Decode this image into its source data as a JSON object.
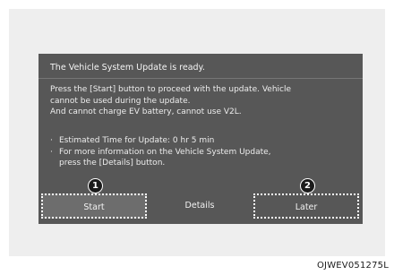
{
  "popup": {
    "title": "The Vehicle System Update is ready.",
    "message_lines": [
      "Press the [Start] button to proceed with the update. Vehicle",
      "cannot be used during the update.",
      "And cannot charge EV battery, cannot use V2L."
    ],
    "bullets": [
      {
        "marker": "·",
        "lines": [
          "Estimated Time for Update: 0 hr 5 min"
        ]
      },
      {
        "marker": "·",
        "lines": [
          "For more information on the Vehicle System Update,",
          "press the [Details] button."
        ]
      }
    ],
    "buttons": {
      "start": "Start",
      "details": "Details",
      "later": "Later"
    }
  },
  "callouts": {
    "start": "1",
    "later": "2"
  },
  "figure_code": "OJWEV051275L",
  "colors": {
    "popup_background": "#575757",
    "page_background": "#eeeeee",
    "highlight_border": "#ffffff"
  }
}
